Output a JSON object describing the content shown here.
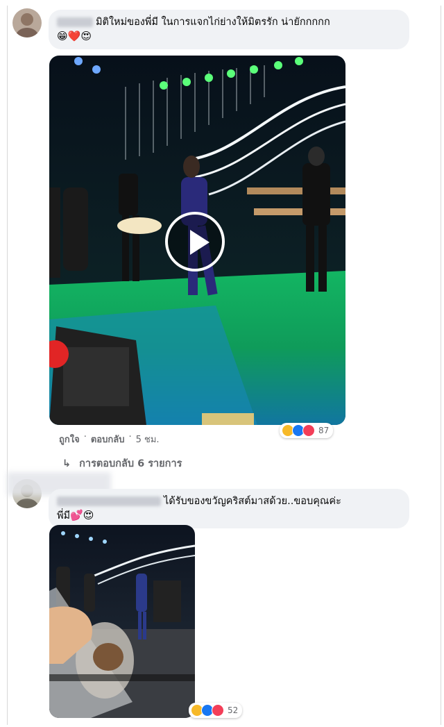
{
  "comment1": {
    "text": "มิติใหม่ของพี่มี ในการแจกไก่ย่างให้มิตรรัก น่ายักกกกก",
    "emojis": "😁❤️😍",
    "reaction_count": "87",
    "actions": {
      "like": "ถูกใจ",
      "reply": "ตอบกลับ",
      "time": "5 ชม.",
      "sep": "·"
    },
    "replies_link": "การตอบกลับ 6 รายการ",
    "reply_arrow": "↳"
  },
  "comment2": {
    "text_line1": "ได้รับของขวัญคริสต์มาสด้วย..ขอบคุณค่ะ",
    "text_line2": "พี่มี",
    "emojis": "💕😍",
    "reaction_count": "52"
  },
  "icons": [
    "play-icon",
    "haha-reaction-icon",
    "like-reaction-icon",
    "love-reaction-icon",
    "reply-arrow-icon"
  ],
  "colors": {
    "bubble": "#f0f2f5",
    "meta": "#65676b",
    "like": "#1877f2",
    "love": "#f33e58",
    "haha": "#f7b928",
    "stage": "#0f9b5a"
  }
}
